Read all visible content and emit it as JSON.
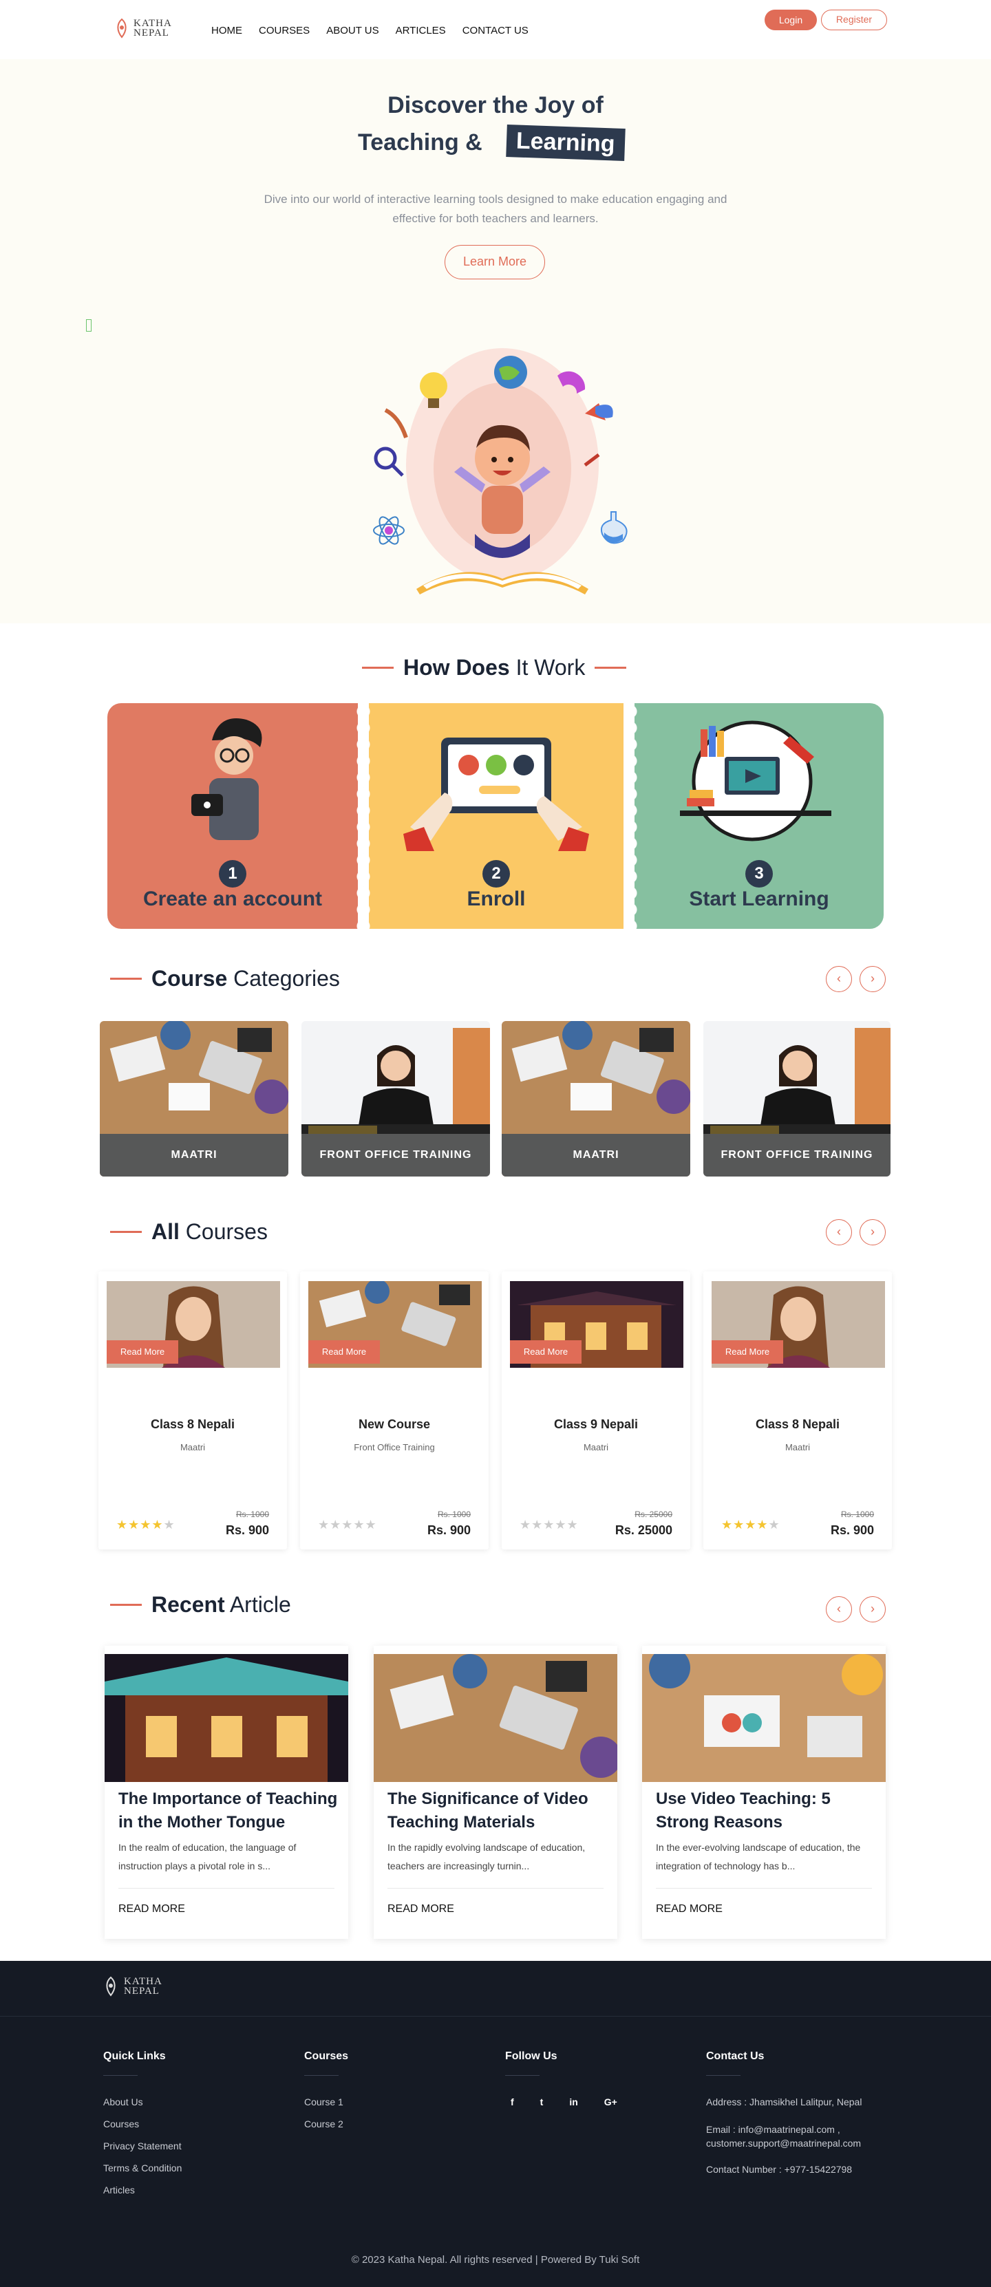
{
  "header": {
    "logo_line1": "KATHA",
    "logo_line2": "NEPAL",
    "nav": [
      "HOME",
      "COURSES",
      "ABOUT US",
      "ARTICLES",
      "CONTACT US"
    ],
    "login_label": "Login",
    "register_label": "Register"
  },
  "hero": {
    "title_line1": "Discover the Joy of",
    "title_line2": "Teaching &",
    "title_highlight": "Learning",
    "description": "Dive into our world of interactive learning tools designed to make education engaging and effective for both teachers and learners.",
    "button_label": "Learn More"
  },
  "how_it_works": {
    "title_bold": "How Does",
    "title_rest": "It Work",
    "steps": [
      {
        "number": "1",
        "label": "Create an account",
        "color": "#e07a62"
      },
      {
        "number": "2",
        "label": "Enroll",
        "color": "#fbc865"
      },
      {
        "number": "3",
        "label": "Start Learning",
        "color": "#86c0a0"
      }
    ]
  },
  "categories": {
    "title_bold": "Course",
    "title_rest": "Categories",
    "items": [
      {
        "label": "MAATRI",
        "icon": "desk-photo"
      },
      {
        "label": "FRONT OFFICE TRAINING",
        "icon": "receptionist-photo"
      },
      {
        "label": "MAATRI",
        "icon": "desk-photo"
      },
      {
        "label": "FRONT OFFICE TRAINING",
        "icon": "receptionist-photo"
      }
    ]
  },
  "courses": {
    "title_bold": "All",
    "title_rest": "Courses",
    "read_more_label": "Read More",
    "items": [
      {
        "title": "Class 8 Nepali",
        "subtitle": "Maatri",
        "old_price": "Rs. 1000",
        "price": "Rs. 900",
        "rating": 4,
        "image": "portrait-photo"
      },
      {
        "title": "New Course",
        "subtitle": "Front Office Training",
        "old_price": "Rs. 1000",
        "price": "Rs. 900",
        "rating": 0,
        "image": "desk-photo"
      },
      {
        "title": "Class 9 Nepali",
        "subtitle": "Maatri",
        "old_price": "Rs. 25000",
        "price": "Rs. 25000",
        "rating": 0,
        "image": "building-photo"
      },
      {
        "title": "Class 8 Nepali",
        "subtitle": "Maatri",
        "old_price": "Rs. 1000",
        "price": "Rs. 900",
        "rating": 4,
        "image": "portrait-photo"
      }
    ]
  },
  "articles": {
    "title_bold": "Recent",
    "title_rest": "Article",
    "read_more_label": "READ MORE",
    "items": [
      {
        "title": "The Importance of Teaching in the Mother Tongue",
        "excerpt": "In the realm of education, the language of instruction plays a pivotal role in s...",
        "image": "building-photo"
      },
      {
        "title": "The Significance of Video Teaching Materials",
        "excerpt": "In the rapidly evolving landscape of education, teachers are increasingly turnin...",
        "image": "desk-photo"
      },
      {
        "title": "Use Video Teaching: 5 Strong Reasons",
        "excerpt": "In the ever-evolving landscape of education, the integration of technology has b...",
        "image": "desk-photo"
      }
    ]
  },
  "footer": {
    "logo_line1": "KATHA",
    "logo_line2": "NEPAL",
    "quick_links": {
      "title": "Quick Links",
      "items": [
        "About Us",
        "Courses",
        "Privacy Statement",
        "Terms & Condition",
        "Articles"
      ]
    },
    "courses": {
      "title": "Courses",
      "items": [
        "Course 1",
        "Course 2"
      ]
    },
    "follow": {
      "title": "Follow Us",
      "items": [
        "f",
        "t",
        "in",
        "G+"
      ],
      "icons": [
        "facebook-icon",
        "twitter-icon",
        "linkedin-icon",
        "google-plus-icon"
      ]
    },
    "contact": {
      "title": "Contact Us",
      "address": "Address : Jhamsikhel Lalitpur, Nepal",
      "email_line1": "Email : info@maatrinepal.com ,",
      "email_line2": "customer.support@maatrinepal.com",
      "phone": "Contact Number : +977-15422798"
    },
    "copyright": "© 2023 Katha Nepal. All rights reserved | Powered By Tuki Soft"
  },
  "colors": {
    "accent": "#e06c57",
    "navy": "#2d3a4e",
    "footer_bg": "#151a24"
  }
}
